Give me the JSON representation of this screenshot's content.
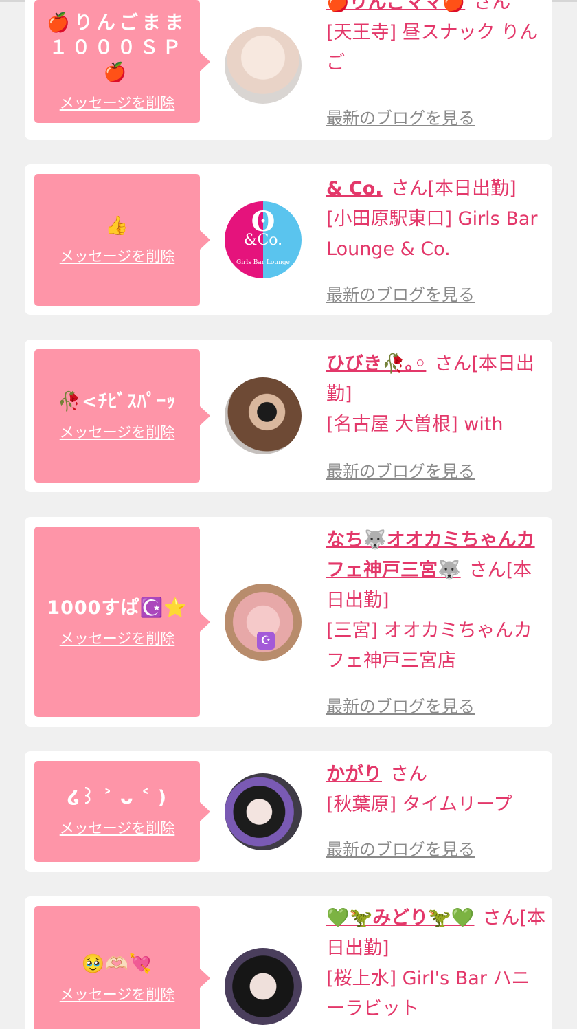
{
  "delete_label": "メッセージを削除",
  "blog_label": "最新のブログを見る",
  "san_label": "さん",
  "colors": {
    "page_bg": "#f0f0f0",
    "card_bg": "#ffffff",
    "bubble": "#fe95a8",
    "accent": "#e3386a",
    "muted": "#8a8a8a"
  },
  "items": [
    {
      "message": "🍎りんごまま１０００ＳＰ🍎",
      "name": "🍎りんごママ🍎",
      "status": "",
      "shop": "[天王寺] 昼スナック りんご",
      "avatar": "photo"
    },
    {
      "message": "👍",
      "name": "& Co.",
      "status": "[本日出勤]",
      "shop": "[小田原駅東口] Girls Bar Lounge & Co.",
      "avatar": "logo",
      "logo": {
        "mark": "ʘ",
        "name": "&Co.",
        "sub": "Girls Bar Lounge"
      }
    },
    {
      "message": "🥀<ﾁﾋﾞｽﾊﾟｰｯ",
      "name": "ひびき🥀｡◦",
      "status": "[本日出勤]",
      "shop": "[名古屋 大曽根] with",
      "avatar": "photo"
    },
    {
      "message": "1000すぱ☪️⭐️",
      "name": "なち🐺オオカミちゃんカフェ神戸三宮🐺",
      "status": "[本日出勤]",
      "shop": "[三宮] オオカミちゃんカフェ神戸三宮店",
      "avatar": "photo",
      "badge": "☪"
    },
    {
      "message": "໒꒱ ˃ ᴗ ˂ )",
      "name": "かがり",
      "status": "",
      "shop": "[秋葉原] タイムリープ",
      "avatar": "photo"
    },
    {
      "message": "🥹🫶🏻💘",
      "name": "💚🦖みどり🦖💚",
      "status": "[本日出勤]",
      "shop": "[桜上水] Girl's Bar ハニーラビット",
      "avatar": "photo"
    }
  ]
}
